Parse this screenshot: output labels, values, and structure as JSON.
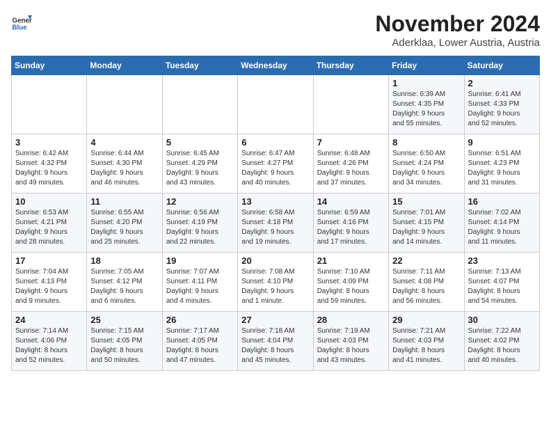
{
  "header": {
    "logo": {
      "line1": "General",
      "line2": "Blue"
    },
    "title": "November 2024",
    "location": "Aderklaa, Lower Austria, Austria"
  },
  "weekdays": [
    "Sunday",
    "Monday",
    "Tuesday",
    "Wednesday",
    "Thursday",
    "Friday",
    "Saturday"
  ],
  "weeks": [
    [
      {
        "day": "",
        "info": ""
      },
      {
        "day": "",
        "info": ""
      },
      {
        "day": "",
        "info": ""
      },
      {
        "day": "",
        "info": ""
      },
      {
        "day": "",
        "info": ""
      },
      {
        "day": "1",
        "info": "Sunrise: 6:39 AM\nSunset: 4:35 PM\nDaylight: 9 hours\nand 55 minutes."
      },
      {
        "day": "2",
        "info": "Sunrise: 6:41 AM\nSunset: 4:33 PM\nDaylight: 9 hours\nand 52 minutes."
      }
    ],
    [
      {
        "day": "3",
        "info": "Sunrise: 6:42 AM\nSunset: 4:32 PM\nDaylight: 9 hours\nand 49 minutes."
      },
      {
        "day": "4",
        "info": "Sunrise: 6:44 AM\nSunset: 4:30 PM\nDaylight: 9 hours\nand 46 minutes."
      },
      {
        "day": "5",
        "info": "Sunrise: 6:45 AM\nSunset: 4:29 PM\nDaylight: 9 hours\nand 43 minutes."
      },
      {
        "day": "6",
        "info": "Sunrise: 6:47 AM\nSunset: 4:27 PM\nDaylight: 9 hours\nand 40 minutes."
      },
      {
        "day": "7",
        "info": "Sunrise: 6:48 AM\nSunset: 4:26 PM\nDaylight: 9 hours\nand 37 minutes."
      },
      {
        "day": "8",
        "info": "Sunrise: 6:50 AM\nSunset: 4:24 PM\nDaylight: 9 hours\nand 34 minutes."
      },
      {
        "day": "9",
        "info": "Sunrise: 6:51 AM\nSunset: 4:23 PM\nDaylight: 9 hours\nand 31 minutes."
      }
    ],
    [
      {
        "day": "10",
        "info": "Sunrise: 6:53 AM\nSunset: 4:21 PM\nDaylight: 9 hours\nand 28 minutes."
      },
      {
        "day": "11",
        "info": "Sunrise: 6:55 AM\nSunset: 4:20 PM\nDaylight: 9 hours\nand 25 minutes."
      },
      {
        "day": "12",
        "info": "Sunrise: 6:56 AM\nSunset: 4:19 PM\nDaylight: 9 hours\nand 22 minutes."
      },
      {
        "day": "13",
        "info": "Sunrise: 6:58 AM\nSunset: 4:18 PM\nDaylight: 9 hours\nand 19 minutes."
      },
      {
        "day": "14",
        "info": "Sunrise: 6:59 AM\nSunset: 4:16 PM\nDaylight: 9 hours\nand 17 minutes."
      },
      {
        "day": "15",
        "info": "Sunrise: 7:01 AM\nSunset: 4:15 PM\nDaylight: 9 hours\nand 14 minutes."
      },
      {
        "day": "16",
        "info": "Sunrise: 7:02 AM\nSunset: 4:14 PM\nDaylight: 9 hours\nand 11 minutes."
      }
    ],
    [
      {
        "day": "17",
        "info": "Sunrise: 7:04 AM\nSunset: 4:13 PM\nDaylight: 9 hours\nand 9 minutes."
      },
      {
        "day": "18",
        "info": "Sunrise: 7:05 AM\nSunset: 4:12 PM\nDaylight: 9 hours\nand 6 minutes."
      },
      {
        "day": "19",
        "info": "Sunrise: 7:07 AM\nSunset: 4:11 PM\nDaylight: 9 hours\nand 4 minutes."
      },
      {
        "day": "20",
        "info": "Sunrise: 7:08 AM\nSunset: 4:10 PM\nDaylight: 9 hours\nand 1 minute."
      },
      {
        "day": "21",
        "info": "Sunrise: 7:10 AM\nSunset: 4:09 PM\nDaylight: 8 hours\nand 59 minutes."
      },
      {
        "day": "22",
        "info": "Sunrise: 7:11 AM\nSunset: 4:08 PM\nDaylight: 8 hours\nand 56 minutes."
      },
      {
        "day": "23",
        "info": "Sunrise: 7:13 AM\nSunset: 4:07 PM\nDaylight: 8 hours\nand 54 minutes."
      }
    ],
    [
      {
        "day": "24",
        "info": "Sunrise: 7:14 AM\nSunset: 4:06 PM\nDaylight: 8 hours\nand 52 minutes."
      },
      {
        "day": "25",
        "info": "Sunrise: 7:15 AM\nSunset: 4:05 PM\nDaylight: 8 hours\nand 50 minutes."
      },
      {
        "day": "26",
        "info": "Sunrise: 7:17 AM\nSunset: 4:05 PM\nDaylight: 8 hours\nand 47 minutes."
      },
      {
        "day": "27",
        "info": "Sunrise: 7:18 AM\nSunset: 4:04 PM\nDaylight: 8 hours\nand 45 minutes."
      },
      {
        "day": "28",
        "info": "Sunrise: 7:19 AM\nSunset: 4:03 PM\nDaylight: 8 hours\nand 43 minutes."
      },
      {
        "day": "29",
        "info": "Sunrise: 7:21 AM\nSunset: 4:03 PM\nDaylight: 8 hours\nand 41 minutes."
      },
      {
        "day": "30",
        "info": "Sunrise: 7:22 AM\nSunset: 4:02 PM\nDaylight: 8 hours\nand 40 minutes."
      }
    ]
  ]
}
